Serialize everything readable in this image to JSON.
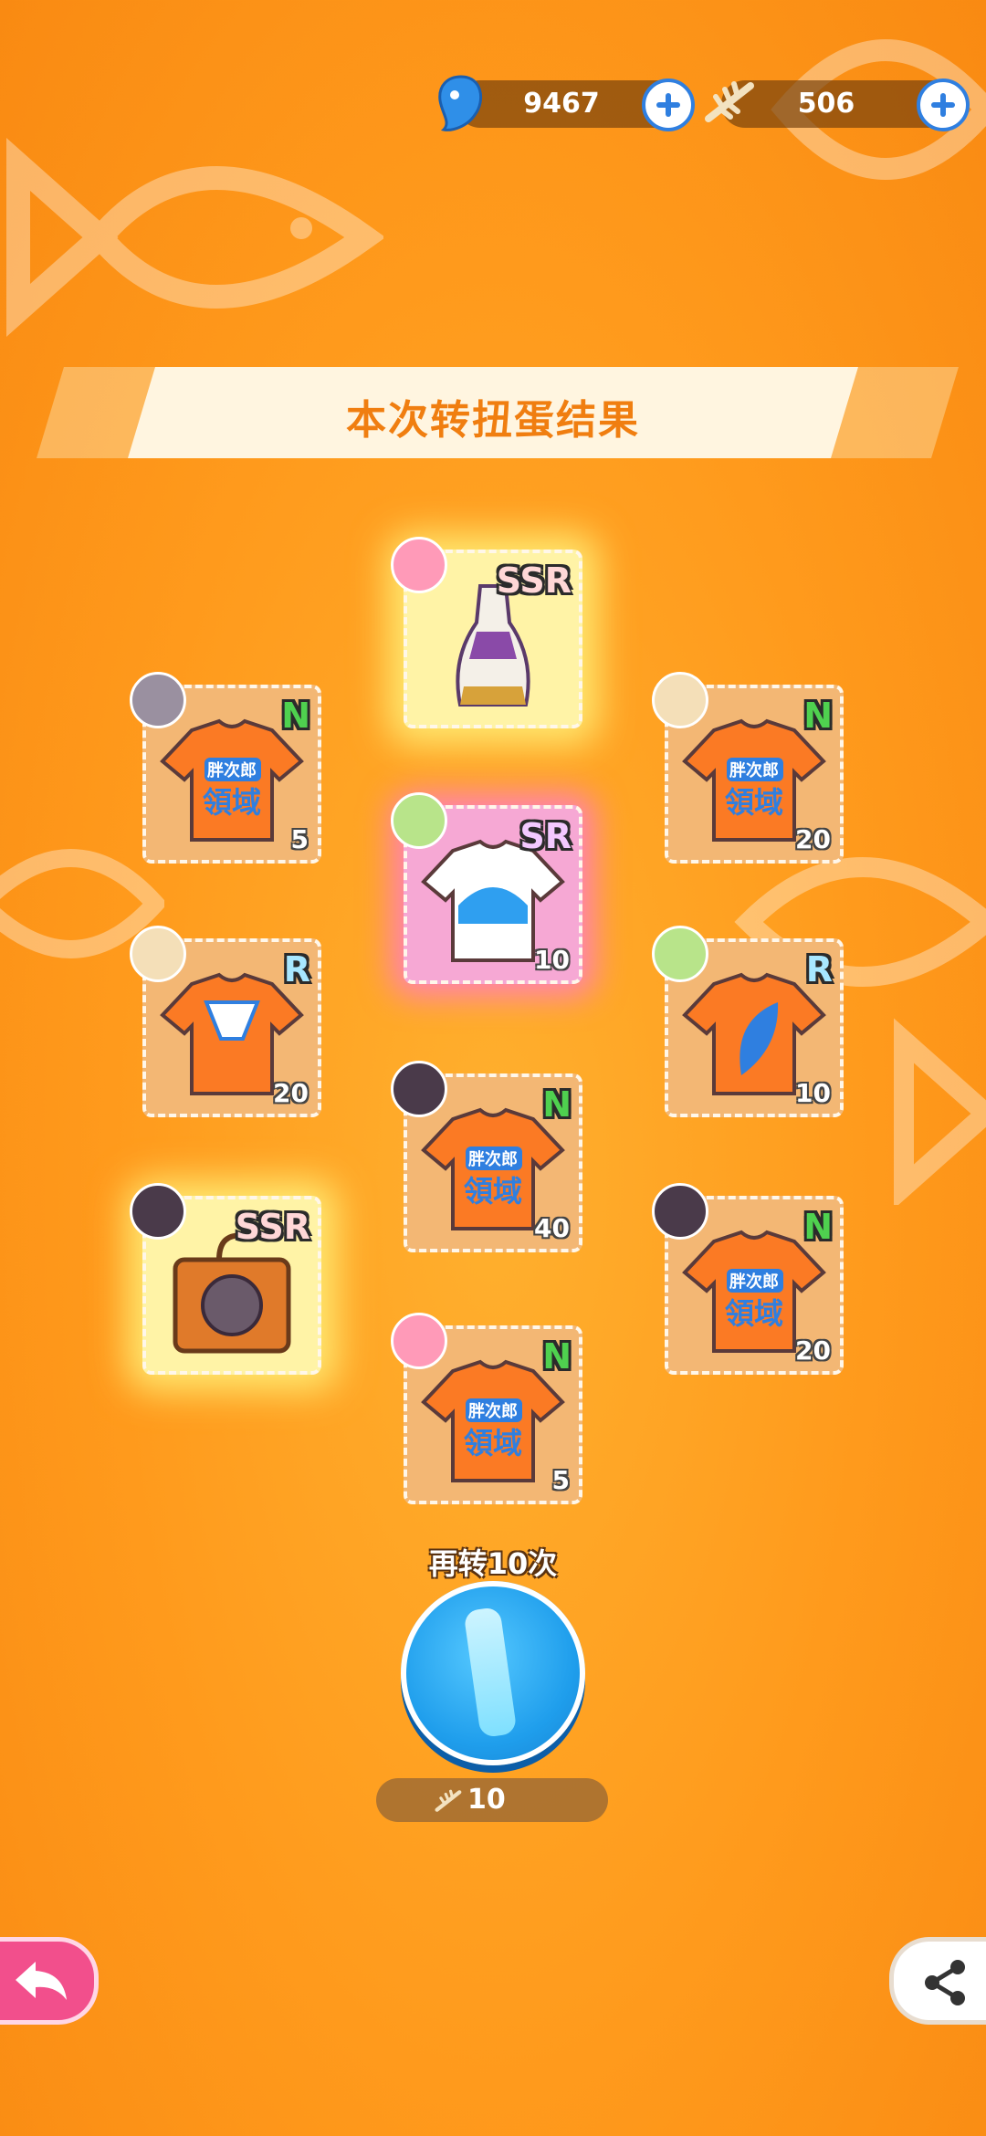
{
  "currency": {
    "gems": "9467",
    "tokens": "506"
  },
  "result_title": "本次转扭蛋结果",
  "items": [
    {
      "rarity": "SSR",
      "count": "",
      "kind": "dress"
    },
    {
      "rarity": "N",
      "count": "5",
      "kind": "shirt-text"
    },
    {
      "rarity": "N",
      "count": "20",
      "kind": "shirt-text"
    },
    {
      "rarity": "SR",
      "count": "10",
      "kind": "shirt-wave"
    },
    {
      "rarity": "R",
      "count": "20",
      "kind": "shirt-sailor"
    },
    {
      "rarity": "R",
      "count": "10",
      "kind": "shirt-leaf"
    },
    {
      "rarity": "N",
      "count": "40",
      "kind": "shirt-text"
    },
    {
      "rarity": "SSR",
      "count": "",
      "kind": "box"
    },
    {
      "rarity": "N",
      "count": "20",
      "kind": "shirt-text"
    },
    {
      "rarity": "N",
      "count": "5",
      "kind": "shirt-text"
    }
  ],
  "spin_again_label": "再转10次",
  "spin_cost": "10",
  "colors": {
    "accent": "#f07e10",
    "button_blue": "#1f9eec",
    "back_pink": "#f24f8c"
  }
}
